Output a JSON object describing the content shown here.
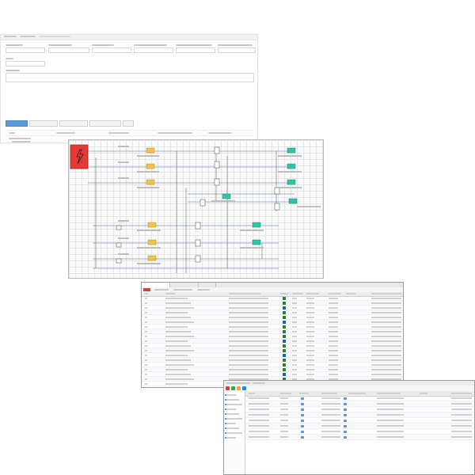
{
  "theme": {
    "accent": "#5b9bd5",
    "button_green": "#4caf50",
    "diagram_source": "#e53935",
    "node_yellow": "#f2c14e",
    "node_teal": "#2ec4a6",
    "line_blue": "#5b7fbf"
  },
  "request_form": {},
  "grid_diagram": {
    "icons": {
      "source": "lightning-icon",
      "switch": "circuit-breaker-icon",
      "consumer": "load-node-icon"
    }
  },
  "signal_table": {},
  "properties_panel": {}
}
